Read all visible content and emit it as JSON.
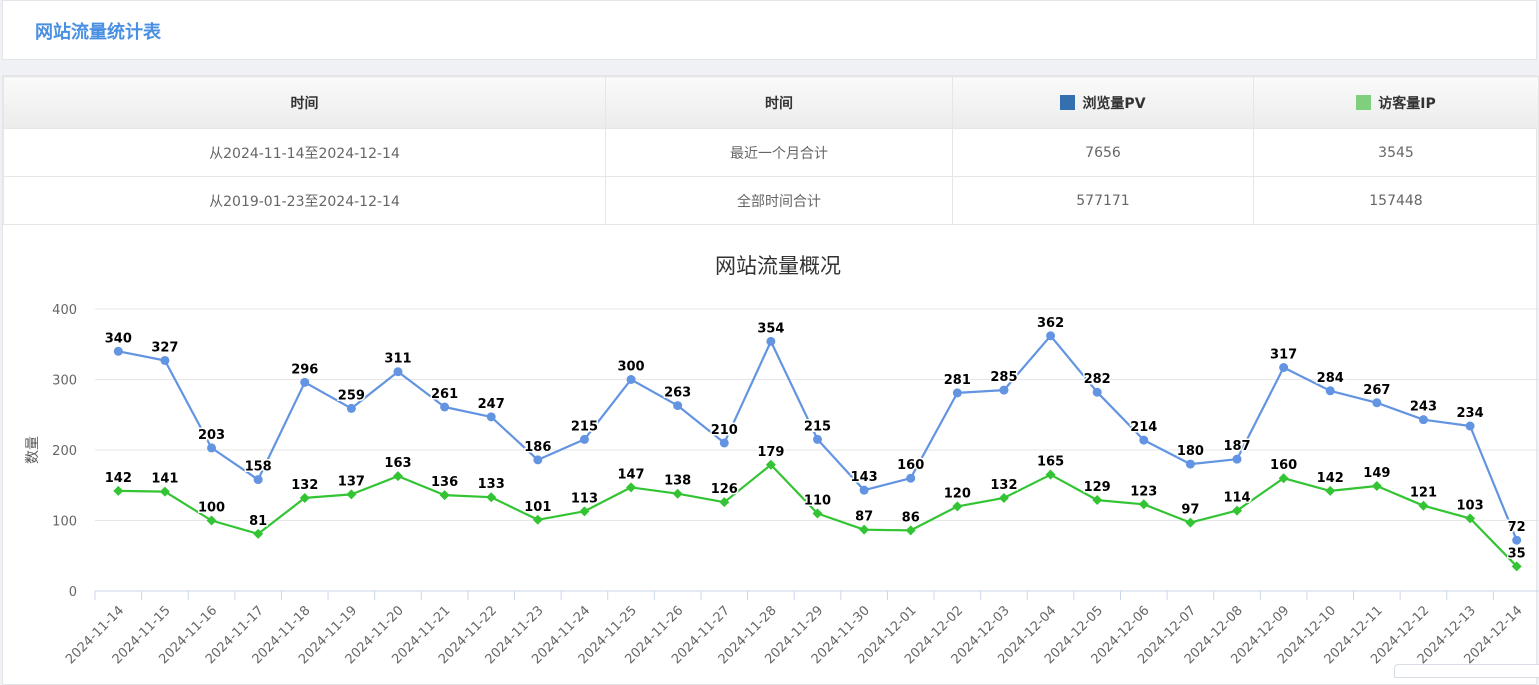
{
  "header": {
    "title": "网站流量统计表"
  },
  "table": {
    "headers": [
      "时间",
      "时间",
      "浏览量PV",
      "访客量IP"
    ],
    "rows": [
      [
        "从2024-11-14至2024-12-14",
        "最近一个月合计",
        "7656",
        "3545"
      ],
      [
        "从2019-01-23至2024-12-14",
        "全部时间合计",
        "577171",
        "157448"
      ]
    ]
  },
  "colors": {
    "pv": "#3470b0",
    "ip": "#7fcf7f",
    "pv_line": "#6394e2",
    "ip_line": "#33c433"
  },
  "chart_data": {
    "type": "line",
    "title": "网站流量概况",
    "ylabel": "数量",
    "ylim": [
      0,
      400
    ],
    "yticks": [
      0,
      100,
      200,
      300,
      400
    ],
    "grid": true,
    "categories": [
      "2024-11-14",
      "2024-11-15",
      "2024-11-16",
      "2024-11-17",
      "2024-11-18",
      "2024-11-19",
      "2024-11-20",
      "2024-11-21",
      "2024-11-22",
      "2024-11-23",
      "2024-11-24",
      "2024-11-25",
      "2024-11-26",
      "2024-11-27",
      "2024-11-28",
      "2024-11-29",
      "2024-11-30",
      "2024-12-01",
      "2024-12-02",
      "2024-12-03",
      "2024-12-04",
      "2024-12-05",
      "2024-12-06",
      "2024-12-07",
      "2024-12-08",
      "2024-12-09",
      "2024-12-10",
      "2024-12-11",
      "2024-12-12",
      "2024-12-13",
      "2024-12-14"
    ],
    "series": [
      {
        "values": [
          340,
          327,
          203,
          158,
          296,
          259,
          311,
          261,
          247,
          186,
          215,
          300,
          263,
          210,
          354,
          215,
          143,
          160,
          281,
          285,
          362,
          282,
          214,
          180,
          187,
          317,
          284,
          267,
          243,
          234,
          72
        ],
        "marker": "circle"
      },
      {
        "values": [
          142,
          141,
          100,
          81,
          132,
          137,
          163,
          136,
          133,
          101,
          113,
          147,
          138,
          126,
          179,
          110,
          87,
          86,
          120,
          132,
          165,
          129,
          123,
          97,
          114,
          160,
          142,
          149,
          121,
          103,
          35
        ],
        "marker": "diamond"
      }
    ]
  }
}
